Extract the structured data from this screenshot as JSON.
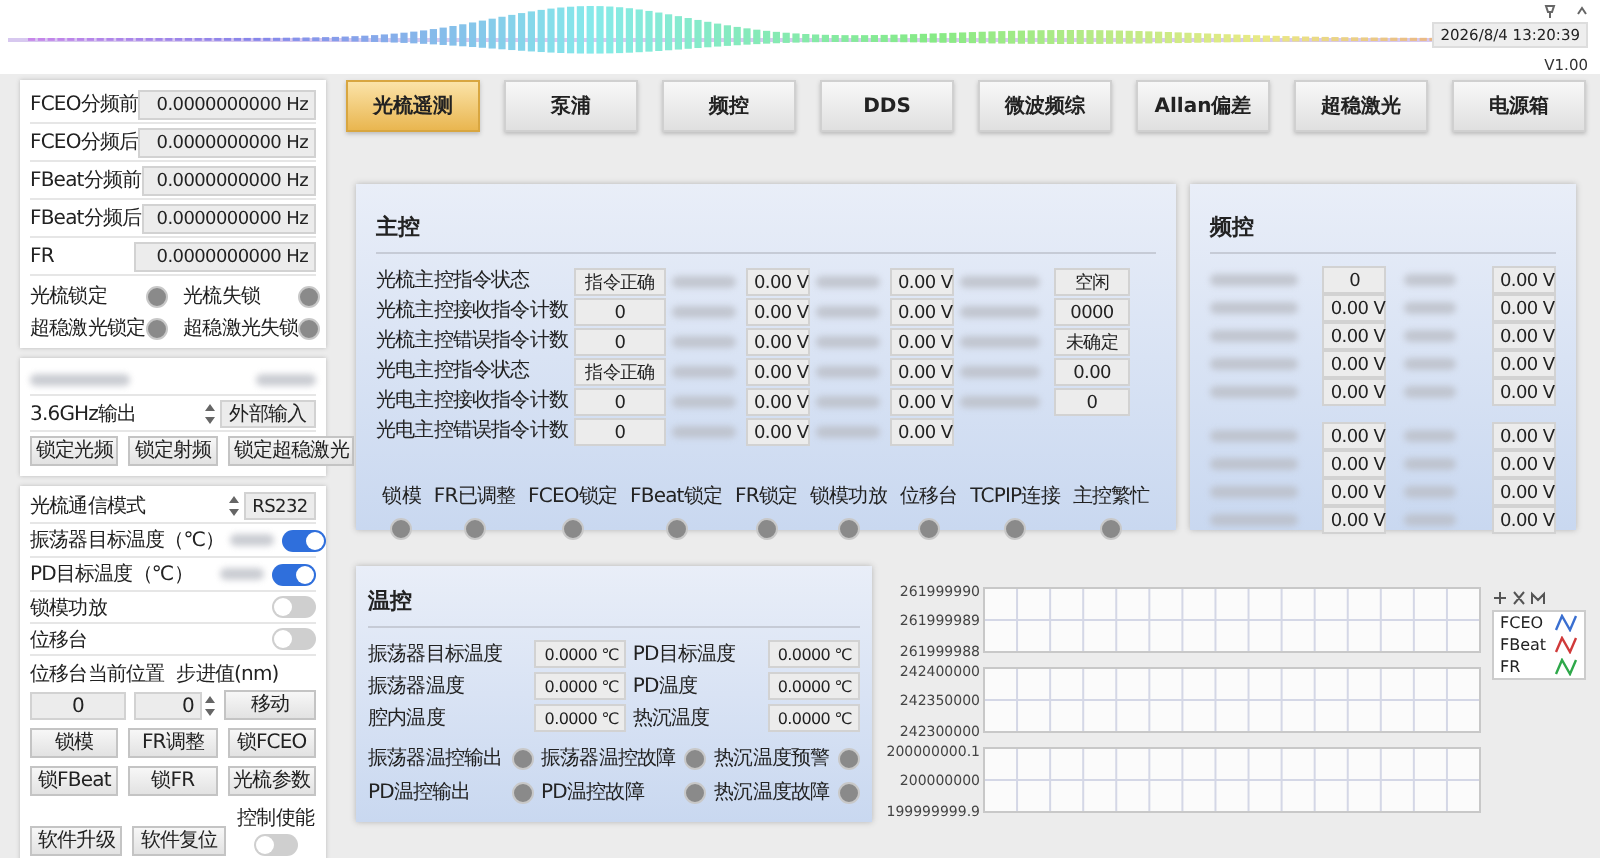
{
  "header": {
    "datetime": "2026/8/4 13:20:39",
    "version": "V1.00"
  },
  "left": {
    "freq_rows": [
      {
        "label": "FCEO分频前",
        "value": "0.0000000000 Hz"
      },
      {
        "label": "FCEO分频后",
        "value": "0.0000000000 Hz"
      },
      {
        "label": "FBeat分频前",
        "value": "0.0000000000 Hz"
      },
      {
        "label": "FBeat分频后",
        "value": "0.0000000000 Hz"
      },
      {
        "label": "FR",
        "value": "0.0000000000 Hz"
      }
    ],
    "lamps": [
      {
        "label": "光梳锁定",
        "on": false
      },
      {
        "label": "光梳失锁",
        "on": false
      },
      {
        "label": "超稳激光锁定",
        "on": false
      },
      {
        "label": "超稳激光失锁",
        "on": false
      }
    ],
    "output": {
      "label": "3.6GHz输出",
      "value": "外部输入"
    },
    "lock_buttons": [
      "锁定光频",
      "锁定射频",
      "锁定超稳激光"
    ],
    "comm": {
      "label": "光梳通信模式",
      "value": "RS232"
    },
    "switches": [
      {
        "label": "振荡器目标温度（℃）",
        "on": true,
        "kind": "spin"
      },
      {
        "label": "PD目标温度（℃）",
        "on": true,
        "kind": "spin"
      },
      {
        "label": "锁模功放",
        "on": false,
        "kind": "plain"
      },
      {
        "label": "位移台",
        "on": false,
        "kind": "plain"
      }
    ],
    "position": {
      "label": "位移台当前位置",
      "value": "0"
    },
    "step": {
      "label": "步进值(nm)",
      "value": "0"
    },
    "move_button": "移动",
    "buttons": [
      "锁模",
      "FR调整",
      "锁FCEO",
      "锁FBeat",
      "锁FR",
      "光梳参数",
      "软件升级",
      "软件复位"
    ],
    "control_enable": {
      "label": "控制使能",
      "on": false
    }
  },
  "tabs": [
    {
      "label": "光梳遥测",
      "selected": true
    },
    {
      "label": "泵浦",
      "selected": false
    },
    {
      "label": "频控",
      "selected": false
    },
    {
      "label": "DDS",
      "selected": false
    },
    {
      "label": "微波频综",
      "selected": false
    },
    {
      "label": "Allan偏差",
      "selected": false
    },
    {
      "label": "超稳激光",
      "selected": false
    },
    {
      "label": "电源箱",
      "selected": false
    }
  ],
  "main": {
    "title": "主控",
    "rows": [
      {
        "label": "光梳主控指令状态",
        "values": [
          "指令正确",
          "0.00 V",
          "0.00 V",
          "空闲"
        ]
      },
      {
        "label": "光梳主控接收指令计数",
        "values": [
          "0",
          "0.00 V",
          "0.00 V",
          "0000"
        ]
      },
      {
        "label": "光梳主控错误指令计数",
        "values": [
          "0",
          "0.00 V",
          "0.00 V",
          "未确定"
        ]
      },
      {
        "label": "光电主控指令状态",
        "values": [
          "指令正确",
          "0.00 V",
          "0.00 V",
          "0.00"
        ]
      },
      {
        "label": "光电主控接收指令计数",
        "values": [
          "0",
          "0.00 V",
          "0.00 V",
          "0"
        ]
      },
      {
        "label": "光电主控错误指令计数",
        "values": [
          "0",
          "0.00 V",
          "0.00 V"
        ]
      }
    ],
    "lamps": [
      {
        "label": "锁模",
        "on": false
      },
      {
        "label": "FR已调整",
        "on": false
      },
      {
        "label": "FCEO锁定",
        "on": false
      },
      {
        "label": "FBeat锁定",
        "on": false
      },
      {
        "label": "FR锁定",
        "on": false
      },
      {
        "label": "锁模功放",
        "on": false
      },
      {
        "label": "位移台",
        "on": false
      },
      {
        "label": "TCPIP连接",
        "on": false
      },
      {
        "label": "主控繁忙",
        "on": false
      }
    ]
  },
  "freq": {
    "title": "频控",
    "groups": [
      [
        [
          "0",
          "0.00 V"
        ],
        [
          "0.00 V",
          "0.00 V"
        ],
        [
          "0.00 V",
          "0.00 V"
        ],
        [
          "0.00 V",
          "0.00 V"
        ],
        [
          "0.00 V",
          "0.00 V"
        ]
      ],
      [
        [
          "0.00 V",
          "0.00 V"
        ],
        [
          "0.00 V",
          "0.00 V"
        ],
        [
          "0.00 V",
          "0.00 V"
        ],
        [
          "0.00 V",
          "0.00 V"
        ]
      ]
    ]
  },
  "temp": {
    "title": "温控",
    "rows": [
      {
        "label": "振荡器目标温度",
        "value": "0.0000 ℃"
      },
      {
        "label": "PD目标温度",
        "value": "0.0000 ℃"
      },
      {
        "label": "振荡器温度",
        "value": "0.0000 ℃"
      },
      {
        "label": "PD温度",
        "value": "0.0000 ℃"
      },
      {
        "label": "腔内温度",
        "value": "0.0000 ℃"
      },
      {
        "label": "热沉温度",
        "value": "0.0000 ℃"
      }
    ],
    "lamps": [
      {
        "label": "振荡器温控输出",
        "on": false
      },
      {
        "label": "振荡器温控故障",
        "on": false
      },
      {
        "label": "热沉温度预警",
        "on": false
      },
      {
        "label": "PD温控输出",
        "on": false
      },
      {
        "label": "PD温控故障",
        "on": false
      },
      {
        "label": "热沉温度故障",
        "on": false
      }
    ]
  },
  "plots": {
    "charts": [
      {
        "y_labels": [
          "261999990",
          "261999989",
          "261999988"
        ]
      },
      {
        "y_labels": [
          "242400000",
          "242350000",
          "242300000"
        ]
      },
      {
        "y_labels": [
          "200000000.1",
          "200000000",
          "199999999.9"
        ]
      }
    ],
    "legend": [
      {
        "name": "FCEO",
        "color": "#3a6fd0"
      },
      {
        "name": "FBeat",
        "color": "#d03a3a"
      },
      {
        "name": "FR",
        "color": "#2ea84a"
      }
    ]
  }
}
